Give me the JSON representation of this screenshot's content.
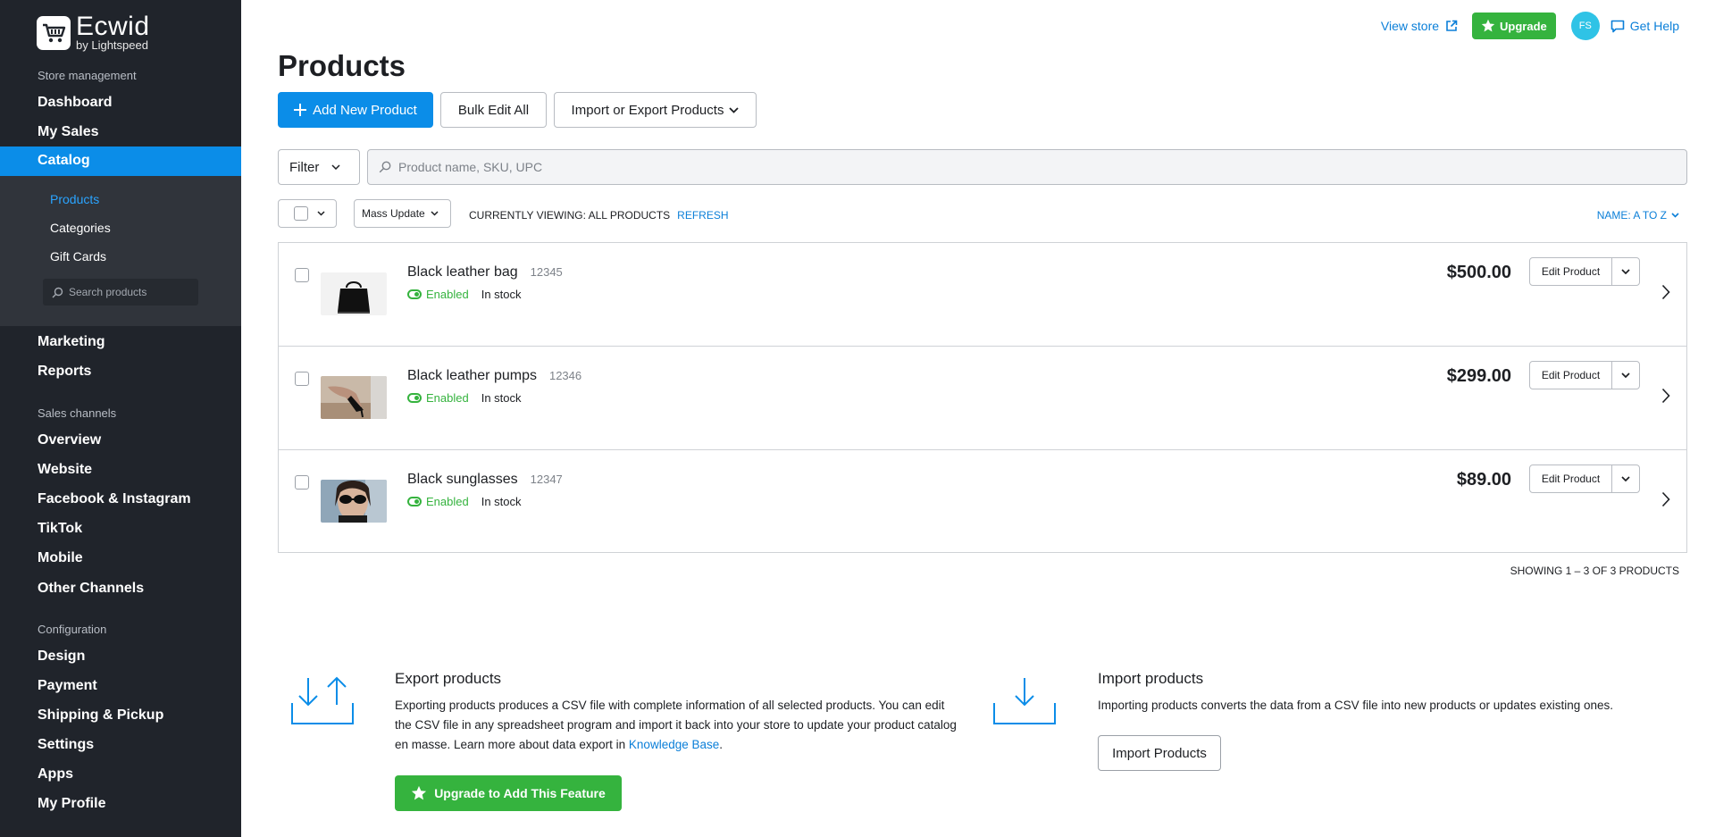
{
  "sidebar": {
    "logo_name": "Ecwid",
    "logo_by": "by Lightspeed",
    "section_store": "Store management",
    "dashboard": "Dashboard",
    "my_sales": "My Sales",
    "catalog": "Catalog",
    "sub_items": [
      "Products",
      "Categories",
      "Gift Cards"
    ],
    "search_placeholder": "Search products",
    "marketing": "Marketing",
    "reports": "Reports",
    "section_channels": "Sales channels",
    "channels": [
      "Overview",
      "Website",
      "Facebook & Instagram",
      "TikTok",
      "Mobile",
      "Other Channels"
    ],
    "section_config": "Configuration",
    "config": [
      "Design",
      "Payment",
      "Shipping & Pickup",
      "Settings",
      "Apps",
      "My Profile"
    ]
  },
  "topbar": {
    "view_store": "View store",
    "upgrade": "Upgrade",
    "avatar_initials": "FS",
    "get_help": "Get Help"
  },
  "page": {
    "title": "Products",
    "add_new": "Add New Product",
    "bulk_edit": "Bulk Edit All",
    "import_export": "Import or Export Products",
    "filter": "Filter",
    "search_placeholder": "Product name, SKU, UPC",
    "mass_update": "Mass Update",
    "viewing": "Currently viewing: All products",
    "refresh": "Refresh",
    "sort": "Name: A to Z",
    "showing": "Showing 1 – 3 of 3 products"
  },
  "products": [
    {
      "name": "Black leather bag",
      "sku": "12345",
      "status": "Enabled",
      "stock": "In stock",
      "price": "$500.00",
      "edit": "Edit Product"
    },
    {
      "name": "Black leather pumps",
      "sku": "12346",
      "status": "Enabled",
      "stock": "In stock",
      "price": "$299.00",
      "edit": "Edit Product"
    },
    {
      "name": "Black sunglasses",
      "sku": "12347",
      "status": "Enabled",
      "stock": "In stock",
      "price": "$89.00",
      "edit": "Edit Product"
    }
  ],
  "export": {
    "title": "Export products",
    "desc1": "Exporting products produces a CSV file with complete information of all selected products. You can edit the CSV file in any spreadsheet program and import it back into your store to update your product catalog en masse. Learn more about data export in",
    "link": "Knowledge Base",
    "desc2": ".",
    "button": "Upgrade to Add This Feature"
  },
  "import": {
    "title": "Import products",
    "desc": "Importing products converts the data from a CSV file into new products or updates existing ones.",
    "button": "Import Products"
  },
  "colors": {
    "sidebar_bg": "#20242b",
    "accent_blue": "#0b8de8",
    "green": "#35b33e"
  }
}
